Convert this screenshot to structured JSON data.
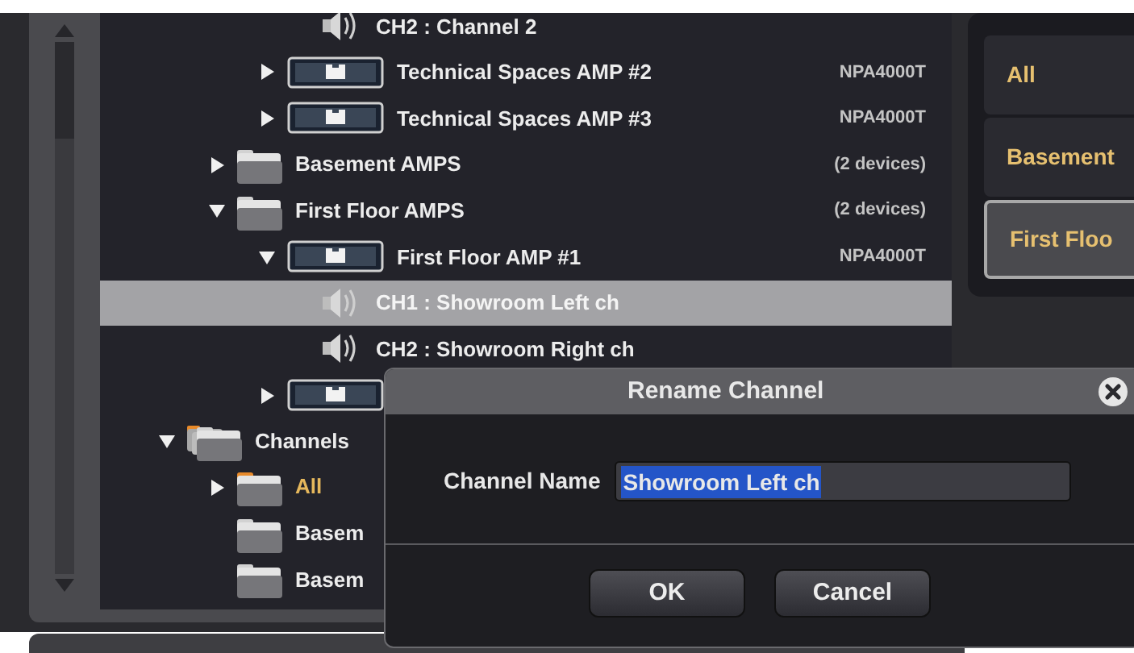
{
  "tree": [
    {
      "children": [
        {
          "children": [
            {
              "children": [
                {
                  "kind": "channel",
                  "label": "CH2 : Channel 2",
                  "selected": false
                }
              ]
            },
            {
              "kind": "amp",
              "label": "Technical Spaces AMP #2",
              "info": "NPA4000T",
              "expanded": false,
              "selected": false
            },
            {
              "kind": "amp",
              "label": "Technical Spaces AMP #3",
              "info": "NPA4000T",
              "expanded": false,
              "selected": false
            }
          ]
        },
        {
          "kind": "device_group",
          "label": "Basement AMPS",
          "info": "(2 devices)",
          "expanded": false,
          "selected": false
        },
        {
          "kind": "device_group",
          "label": "First Floor AMPS",
          "info": "(2 devices)",
          "expanded": true,
          "selected": false,
          "children": [
            {
              "kind": "amp",
              "label": "First Floor AMP #1",
              "info": "NPA4000T",
              "expanded": true,
              "selected": false,
              "children": [
                {
                  "kind": "channel",
                  "label": "CH1 : Showroom Left ch",
                  "selected": true
                },
                {
                  "kind": "channel",
                  "label": "CH2 : Showroom Right ch",
                  "selected": false
                }
              ]
            },
            {
              "kind": "amp",
              "expanded": false,
              "selected": false
            }
          ]
        }
      ]
    },
    {
      "kind": "channels_root",
      "label": "Channels",
      "expanded": true,
      "selected": false,
      "children": [
        {
          "kind": "channel_group",
          "label": "All",
          "active": true,
          "expanded": false,
          "selected": false
        },
        {
          "kind": "channel_group",
          "label": "Basem",
          "active": false,
          "selected": false
        },
        {
          "kind": "channel_group",
          "label": "Basem",
          "active": false,
          "selected": false
        }
      ]
    }
  ],
  "groups": [
    {
      "label": "All",
      "selected": false
    },
    {
      "label": "Basement",
      "selected": false
    },
    {
      "label": "First Floo",
      "selected": true
    }
  ],
  "dialog": {
    "title": "Rename Channel",
    "field_label": "Channel Name",
    "value": "Showroom Left ch",
    "value_selected": true,
    "buttons": [
      "OK",
      "Cancel"
    ]
  }
}
